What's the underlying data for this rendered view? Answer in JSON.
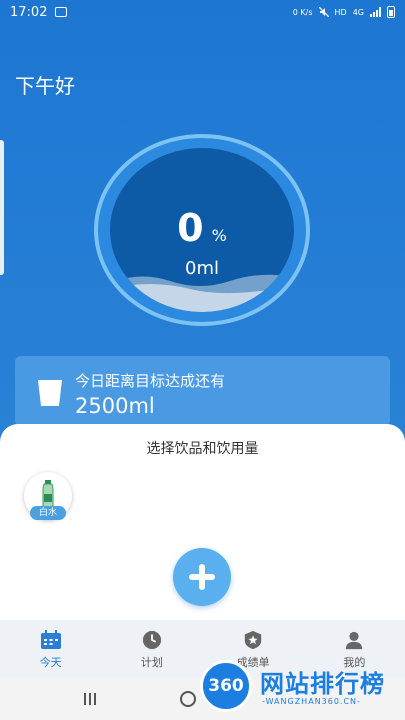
{
  "status_bar": {
    "time": "17:02",
    "net_speed": "0 K/s",
    "hd": "HD",
    "network": "4G"
  },
  "greeting": "下午好",
  "progress": {
    "percent": "0",
    "percent_sign": "%",
    "volume": "0ml"
  },
  "goal_card": {
    "label": "今日距离目标达成还有",
    "value": "2500ml"
  },
  "sheet": {
    "title": "选择饮品和饮用量",
    "drinks": [
      {
        "label": "白水",
        "icon": "water-bottle-icon"
      }
    ],
    "add_icon": "plus-icon"
  },
  "tabs": [
    {
      "label": "今天",
      "icon": "calendar-icon",
      "active": true
    },
    {
      "label": "计划",
      "icon": "clock-icon",
      "active": false
    },
    {
      "label": "成绩单",
      "icon": "badge-star-icon",
      "active": false
    },
    {
      "label": "我的",
      "icon": "user-icon",
      "active": false
    }
  ],
  "watermark": {
    "logo": "360",
    "text": "网站排行榜",
    "sub": "-WANGZHAN360.CN-"
  },
  "colors": {
    "primary": "#1f78cf",
    "accent": "#5ab0ef",
    "active_tab": "#2a7fd4"
  }
}
